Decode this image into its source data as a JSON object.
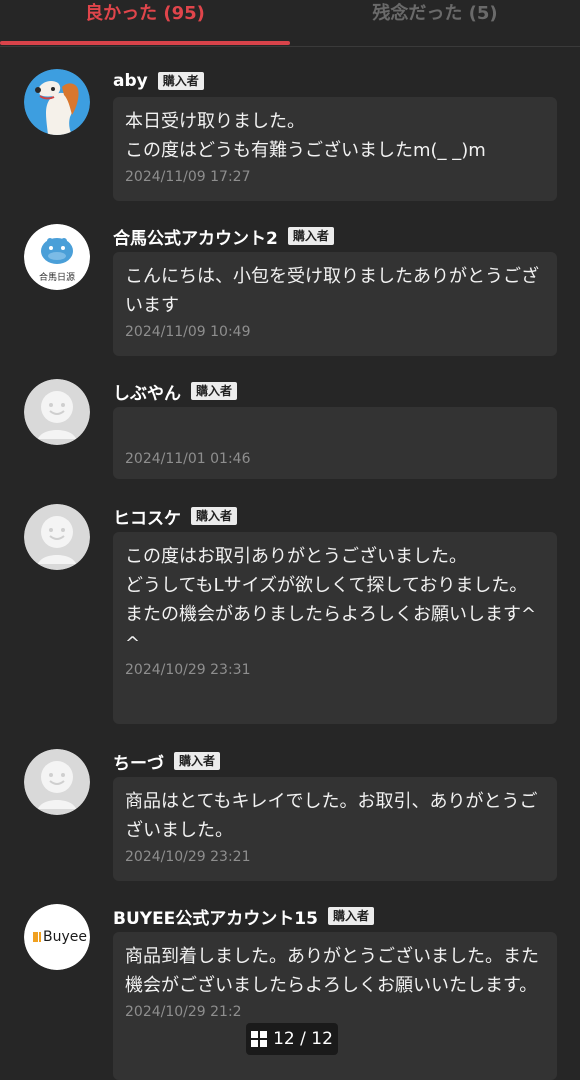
{
  "tabs": {
    "good_label": "良かった (95)",
    "bad_label": "残念だった (5)"
  },
  "colors": {
    "accent": "#d8434a",
    "background": "#262626",
    "bubble": "#333333"
  },
  "reviews": [
    {
      "username": "aby",
      "badge": "購入者",
      "avatar": "dog-avatar",
      "message": "本日受け取りました。\nこの度はどうも有難うございましたm(_ _)m",
      "date": "2024/11/09 17:27"
    },
    {
      "username": "合馬公式アカウント2",
      "badge": "購入者",
      "avatar": "hippo-logo-avatar",
      "avatar_text": "合馬日源",
      "message": "こんにちは、小包を受け取りましたありがとうございます",
      "date": "2024/11/09 10:49"
    },
    {
      "username": "しぶやん",
      "badge": "購入者",
      "avatar": "default-face-avatar",
      "message": "",
      "date": "2024/11/01 01:46"
    },
    {
      "username": "ヒコスケ",
      "badge": "購入者",
      "avatar": "default-face-avatar",
      "message": "この度はお取引ありがとうございました。\nどうしてもLサイズが欲しくて探しておりました。\nまたの機会がありましたらよろしくお願いします^ ^",
      "date": "2024/10/29 23:31"
    },
    {
      "username": "ちーづ",
      "badge": "購入者",
      "avatar": "default-face-avatar",
      "message": "商品はとてもキレイでした。お取引、ありがとうございました。",
      "date": "2024/10/29 23:21"
    },
    {
      "username": "BUYEE公式アカウント15",
      "badge": "購入者",
      "avatar": "buyee-logo-avatar",
      "avatar_text": "Buyee",
      "message": "商品到着しました。ありがとうございました。また機会がございましたらよろしくお願いいたします。",
      "date": "2024/10/29 21:2"
    }
  ],
  "pager": {
    "label": "12 / 12",
    "icon": "grid-icon"
  }
}
